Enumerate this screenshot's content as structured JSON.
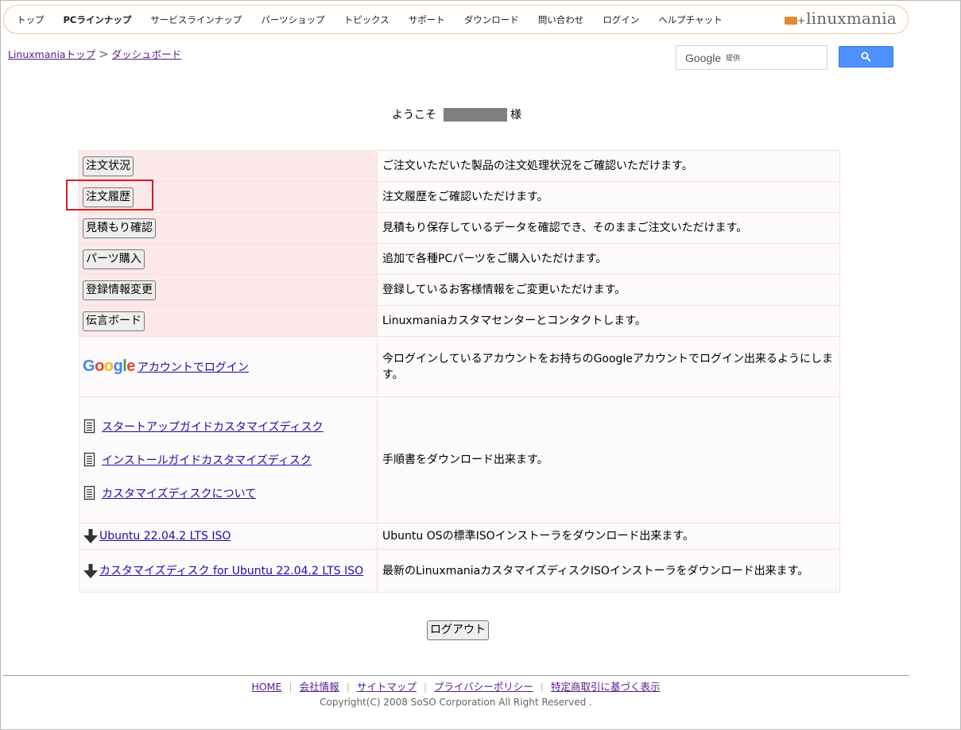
{
  "nav": {
    "items": [
      {
        "label": "トップ",
        "bold": false
      },
      {
        "label": "PCラインナップ",
        "bold": true
      },
      {
        "label": "サービスラインナップ",
        "bold": false
      },
      {
        "label": "パーツショップ",
        "bold": false
      },
      {
        "label": "トピックス",
        "bold": false
      },
      {
        "label": "サポート",
        "bold": false
      },
      {
        "label": "ダウンロード",
        "bold": false
      },
      {
        "label": "問い合わせ",
        "bold": false
      },
      {
        "label": "ログイン",
        "bold": false
      },
      {
        "label": "ヘルプチャット",
        "bold": false
      }
    ],
    "logo_text": "linuxmania",
    "logo_plus": "+"
  },
  "breadcrumb": {
    "home": "Linuxmaniaトップ",
    "separator": ">",
    "current": "ダッシュボード"
  },
  "search": {
    "brand": "Google",
    "provided": "提供",
    "button_icon": "search-icon"
  },
  "welcome": {
    "prefix": "ようこそ",
    "suffix": "様"
  },
  "menu": [
    {
      "label": "注文状況",
      "desc": "ご注文いただいた製品の注文処理状況をご確認いただけます。"
    },
    {
      "label": "注文履歴",
      "desc": "注文履歴をご確認いただけます。"
    },
    {
      "label": "見積もり確認",
      "desc": "見積もり保存しているデータを確認でき、そのままご注文いただけます。"
    },
    {
      "label": "パーツ購入",
      "desc": "追加で各種PCパーツをご購入いただけます。"
    },
    {
      "label": "登録情報変更",
      "desc": "登録しているお客様情報をご変更いただけます。"
    },
    {
      "label": "伝言ボード",
      "desc": "Linuxmaniaカスタマセンターとコンタクトします。"
    }
  ],
  "google_login": {
    "logo_letters": [
      "G",
      "o",
      "o",
      "g",
      "l",
      "e"
    ],
    "logo_colors": [
      "#4285F4",
      "#EA4335",
      "#FBBC05",
      "#4285F4",
      "#34A853",
      "#EA4335"
    ],
    "link": "アカウントでログイン",
    "desc": "今ログインしているアカウントをお持ちのGoogleアカウントでログイン出来るようにします。"
  },
  "docs": {
    "links": [
      "スタートアップガイドカスタマイズディスク",
      "インストールガイドカスタマイズディスク",
      "カスタマイズディスクについて"
    ],
    "desc": "手順書をダウンロード出来ます。"
  },
  "iso": [
    {
      "link": "Ubuntu 22.04.2 LTS ISO",
      "desc": "Ubuntu OSの標準ISOインストーラをダウンロード出来ます。"
    },
    {
      "link": "カスタマイズディスク for Ubuntu 22.04.2 LTS ISO",
      "desc": "最新のLinuxmaniaカスタマイズディスクISOインストーラをダウンロード出来ます。"
    }
  ],
  "logout": "ログアウト",
  "footer": {
    "links": [
      "HOME",
      "会社情報",
      "サイトマップ",
      "プライバシーポリシー",
      "特定商取引に基づく表示"
    ],
    "separator": "|",
    "copyright": "Copyright(C) 2008 SoSO Corporation All Right Reserved ."
  },
  "colors": {
    "nav_border": "#f2c79a",
    "row_tint": "#fde9ea",
    "highlight": "#d42020",
    "search_button": "#4d90fe",
    "link": "#1a0dab",
    "visited_link": "#551a8b"
  }
}
